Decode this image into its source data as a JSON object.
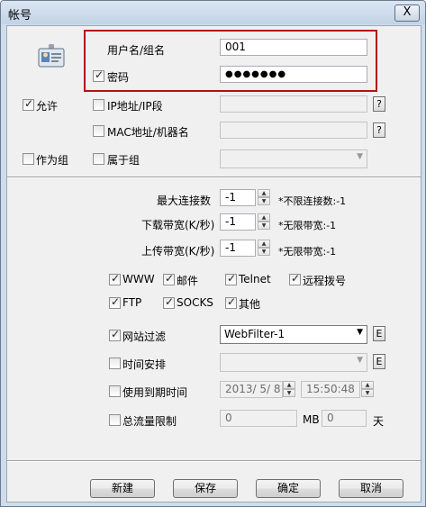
{
  "window": {
    "title": "帐号",
    "close_glyph": "X"
  },
  "account": {
    "username_label": "用户名/组名",
    "username_value": "001",
    "password_label": "密码",
    "password_value": "●●●●●●●",
    "password_checked": true
  },
  "access": {
    "allow_label": "允许",
    "ip_label": "IP地址/IP段",
    "mac_label": "MAC地址/机器名",
    "group_label": "作为组",
    "member_of_label": "属于组",
    "help_glyph": "?"
  },
  "limits": {
    "max_conn_label": "最大连接数",
    "max_conn_value": "-1",
    "max_conn_hint": "*不限连接数:-1",
    "down_label": "下载带宽(K/秒)",
    "down_value": "-1",
    "down_hint": "*无限带宽:-1",
    "up_label": "上传带宽(K/秒)",
    "up_value": "-1",
    "up_hint": "*无限带宽:-1"
  },
  "services": [
    {
      "label": "WWW",
      "checked": true
    },
    {
      "label": "邮件",
      "checked": true
    },
    {
      "label": "Telnet",
      "checked": true
    },
    {
      "label": "远程拨号",
      "checked": true
    },
    {
      "label": "FTP",
      "checked": true
    },
    {
      "label": "SOCKS",
      "checked": true
    },
    {
      "label": "其他",
      "checked": true
    }
  ],
  "filters": {
    "web_filter_label": "网站过滤",
    "web_filter_value": "WebFilter-1",
    "schedule_label": "时间安排",
    "edit_glyph": "E",
    "expiry_label": "使用到期时间",
    "expiry_date": "2013/ 5/ 8",
    "expiry_time": "15:50:48",
    "quota_label": "总流量限制",
    "quota_mb_value": "0",
    "quota_mb_unit": "MB",
    "quota_days_value": "0",
    "quota_days_unit": "天"
  },
  "buttons": {
    "new": "新建",
    "save": "保存",
    "ok": "确定",
    "cancel": "取消"
  }
}
